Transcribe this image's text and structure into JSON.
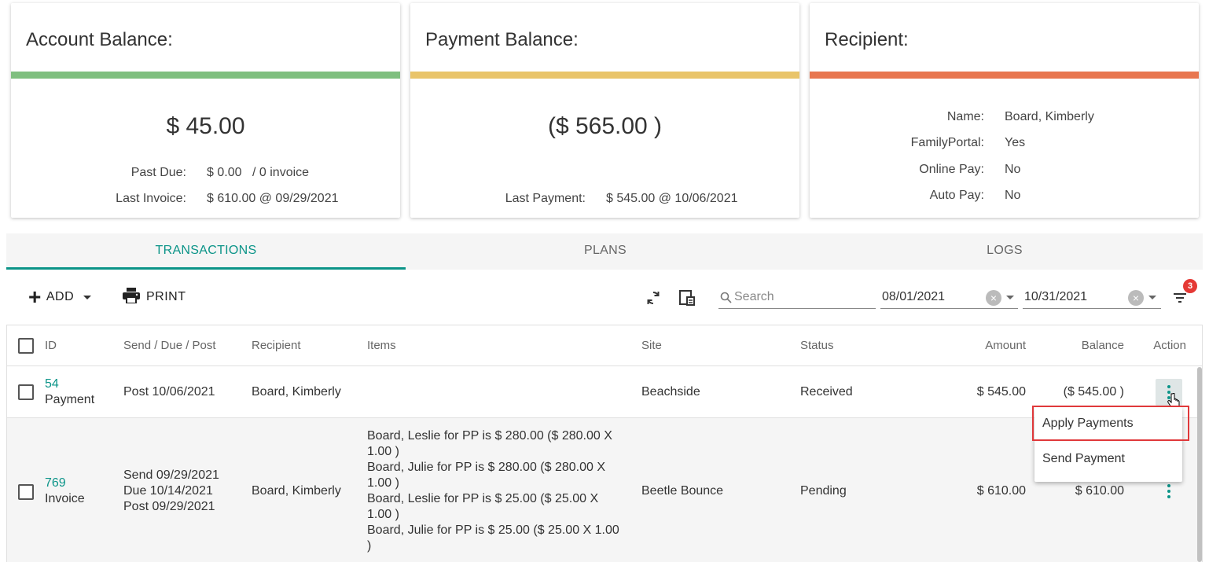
{
  "cards": {
    "account": {
      "title": "Account Balance:",
      "bar_color": "#7fbf7f",
      "amount": "$ 45.00",
      "past_due_label": "Past Due:",
      "past_due_value": "$ 0.00",
      "past_due_invoices": "/ 0 invoice",
      "last_invoice_label": "Last Invoice:",
      "last_invoice_value": "$ 610.00 @ 09/29/2021"
    },
    "payment": {
      "title": "Payment Balance:",
      "bar_color": "#e9c46a",
      "amount": "($ 565.00 )",
      "last_payment_label": "Last Payment:",
      "last_payment_value": "$ 545.00 @ 10/06/2021"
    },
    "recipient": {
      "title": "Recipient:",
      "bar_color": "#e8764f",
      "rows": [
        {
          "label": "Name:",
          "value": "Board, Kimberly"
        },
        {
          "label": "FamilyPortal:",
          "value": "Yes"
        },
        {
          "label": "Online Pay:",
          "value": "No"
        },
        {
          "label": "Auto Pay:",
          "value": "No"
        }
      ]
    }
  },
  "tabs": [
    "TRANSACTIONS",
    "PLANS",
    "LOGS"
  ],
  "active_tab": "TRANSACTIONS",
  "toolbar": {
    "add_label": "ADD",
    "print_label": "PRINT",
    "search_placeholder": "Search",
    "date_from": "08/01/2021",
    "date_to": "10/31/2021",
    "filter_badge": "3"
  },
  "table": {
    "columns": [
      "ID",
      "Send / Due / Post",
      "Recipient",
      "Items",
      "Site",
      "Status",
      "Amount",
      "Balance",
      "Action"
    ],
    "rows": [
      {
        "id": "54",
        "type": "Payment",
        "dates": [
          "Post 10/06/2021"
        ],
        "recipient": "Board, Kimberly",
        "items": [],
        "site": "Beachside",
        "status": "Received",
        "amount": "$ 545.00",
        "balance": "($ 545.00 )"
      },
      {
        "id": "769",
        "type": "Invoice",
        "dates": [
          "Send 09/29/2021",
          "Due 10/14/2021",
          "Post 09/29/2021"
        ],
        "recipient": "Board, Kimberly",
        "items": [
          "Board, Leslie for PP is $ 280.00 ($ 280.00 X",
          "1.00 )",
          "Board, Julie for PP is $ 280.00 ($ 280.00 X",
          "1.00 )",
          "Board, Leslie for PP is $ 25.00 ($ 25.00 X",
          "1.00 )",
          "Board, Julie for PP is $ 25.00 ($ 25.00 X 1.00",
          ")"
        ],
        "site": "Beetle Bounce",
        "status": "Pending",
        "amount": "$ 610.00",
        "balance": "$ 610.00"
      }
    ]
  },
  "action_menu": {
    "items": [
      "Apply Payments",
      "Send Payment"
    ]
  },
  "colors": {
    "accent": "#0b9488",
    "badge": "#e53935",
    "highlight": "#e0393b"
  }
}
